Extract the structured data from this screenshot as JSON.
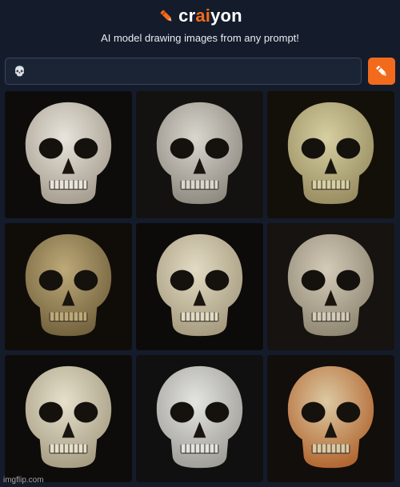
{
  "app": {
    "brand_prefix": "cr",
    "brand_accent": "ai",
    "brand_suffix": "yon",
    "tagline": "AI model drawing images from any prompt!",
    "accent_color": "#f26b1d",
    "logo_icon": "crayon-icon"
  },
  "search": {
    "value": "💀",
    "submit_icon": "crayon-icon"
  },
  "results": [
    {
      "icon": "skull-icon",
      "bone": "#e8e4dc",
      "shade": "#a39b8c",
      "bg": "#0e0c0b"
    },
    {
      "icon": "skull-icon",
      "bone": "#d9d6ce",
      "shade": "#8c877d",
      "bg": "#141210"
    },
    {
      "icon": "skull-icon",
      "bone": "#d6cfa2",
      "shade": "#958a5e",
      "bg": "#121008"
    },
    {
      "icon": "skull-icon",
      "bone": "#bda978",
      "shade": "#6f5f3b",
      "bg": "#100d09"
    },
    {
      "icon": "skull-icon",
      "bone": "#e2dbc3",
      "shade": "#a3987c",
      "bg": "#0d0b09"
    },
    {
      "icon": "skull-icon",
      "bone": "#d3cbb8",
      "shade": "#8d8470",
      "bg": "#161310"
    },
    {
      "icon": "skull-icon",
      "bone": "#e6e0cb",
      "shade": "#a39a80",
      "bg": "#0e0c0a"
    },
    {
      "icon": "skull-icon",
      "bone": "#e4e4e0",
      "shade": "#9c9b96",
      "bg": "#101011"
    },
    {
      "icon": "skull-icon",
      "bone": "#dcc9a3",
      "shade": "#b0612a",
      "bg": "#120e0b"
    }
  ],
  "watermark": "imgflip.com"
}
